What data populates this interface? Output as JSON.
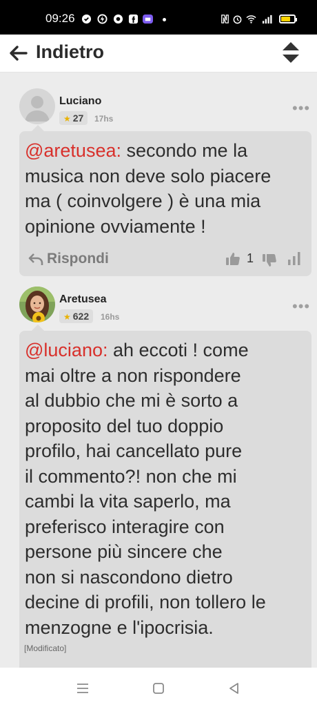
{
  "status_bar": {
    "time": "09:26",
    "battery_level": 0.7,
    "icons": [
      "app-icon",
      "app-icon",
      "chrome-icon",
      "facebook-icon",
      "app-icon",
      "nfc-icon",
      "alarm-icon",
      "wifi-icon",
      "signal-icon",
      "battery-icon"
    ]
  },
  "header": {
    "back_icon": "arrow-left-icon",
    "title": "Indietro",
    "sort_icon": "sort-icon"
  },
  "comments": [
    {
      "author": "Luciano",
      "points": "27",
      "time_ago": "17hs",
      "more": "•••",
      "avatar": "default-avatar-icon",
      "mention": "@aretusea:",
      "lines": [
        " secondo me la",
        "musica non deve solo piacere",
        "ma ( coinvolgere ) è una mia",
        "opinione ovviamente !"
      ],
      "reply_label": "Rispondi",
      "likes": "1"
    },
    {
      "author": "Aretusea",
      "points": "622",
      "time_ago": "16hs",
      "more": "•••",
      "avatar": "user-photo-avatar",
      "mention": "@luciano:",
      "lines": [
        " ah eccoti ! come",
        "mai oltre a non rispondere",
        "al dubbio che mi è sorto a",
        "proposito del tuo doppio",
        "profilo, hai cancellato pure",
        "il commento?! non che mi",
        "cambi la vita saperlo, ma",
        "preferisco interagire con",
        "persone più sincere che",
        "non si nascondono dietro",
        "decine di profili, non tollero le",
        "menzogne e l'ipocrisia."
      ],
      "edited": "[Modificato]"
    }
  ],
  "nav_bar": {
    "icons": [
      "menu-icon",
      "home-icon",
      "back-icon"
    ]
  },
  "colors": {
    "mention": "#d8302b",
    "star": "#e9b200",
    "feed_background": "#ececec",
    "bubble_background": "#dcdcdc"
  }
}
